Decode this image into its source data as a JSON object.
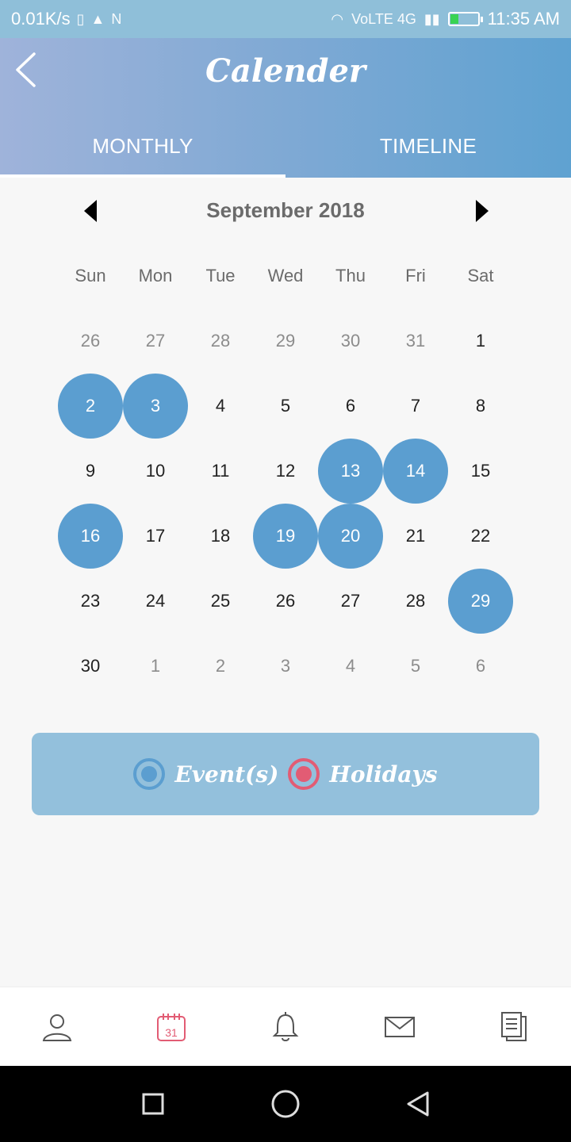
{
  "status_bar": {
    "speed": "0.01K/s",
    "carrier_text": "VoLTE 4G",
    "time": "11:35 AM",
    "battery_level": 0.3,
    "battery_color": "#39d353"
  },
  "header": {
    "title": "Calender",
    "tabs": [
      {
        "label": "MONTHLY",
        "active": true
      },
      {
        "label": "TIMELINE",
        "active": false
      }
    ]
  },
  "calendar": {
    "month_label": "September 2018",
    "weekdays": [
      "Sun",
      "Mon",
      "Tue",
      "Wed",
      "Thu",
      "Fri",
      "Sat"
    ],
    "days": [
      {
        "d": "26",
        "muted": true
      },
      {
        "d": "27",
        "muted": true
      },
      {
        "d": "28",
        "muted": true
      },
      {
        "d": "29",
        "muted": true
      },
      {
        "d": "30",
        "muted": true
      },
      {
        "d": "31",
        "muted": true
      },
      {
        "d": "1"
      },
      {
        "d": "2",
        "event": true
      },
      {
        "d": "3",
        "event": true
      },
      {
        "d": "4"
      },
      {
        "d": "5"
      },
      {
        "d": "6"
      },
      {
        "d": "7"
      },
      {
        "d": "8"
      },
      {
        "d": "9"
      },
      {
        "d": "10"
      },
      {
        "d": "11"
      },
      {
        "d": "12"
      },
      {
        "d": "13",
        "event": true
      },
      {
        "d": "14",
        "event": true
      },
      {
        "d": "15"
      },
      {
        "d": "16",
        "event": true
      },
      {
        "d": "17"
      },
      {
        "d": "18"
      },
      {
        "d": "19",
        "event": true
      },
      {
        "d": "20",
        "event": true
      },
      {
        "d": "21"
      },
      {
        "d": "22"
      },
      {
        "d": "23"
      },
      {
        "d": "24"
      },
      {
        "d": "25"
      },
      {
        "d": "26"
      },
      {
        "d": "27"
      },
      {
        "d": "28"
      },
      {
        "d": "29",
        "event": true
      },
      {
        "d": "30"
      },
      {
        "d": "1",
        "muted": true
      },
      {
        "d": "2",
        "muted": true
      },
      {
        "d": "3",
        "muted": true
      },
      {
        "d": "4",
        "muted": true
      },
      {
        "d": "5",
        "muted": true
      },
      {
        "d": "6",
        "muted": true
      }
    ],
    "event_color": "#5b9ed0"
  },
  "legend": {
    "events_label": "Event(s)",
    "holidays_label": "Holidays",
    "event_color": "#5b9ed0",
    "holiday_color": "#e25c74"
  },
  "bottom_nav": {
    "items": [
      {
        "icon": "profile-icon"
      },
      {
        "icon": "calendar-icon",
        "text": "31",
        "active": true
      },
      {
        "icon": "bell-icon"
      },
      {
        "icon": "mail-icon"
      },
      {
        "icon": "documents-icon"
      }
    ],
    "active_color": "#e25c74"
  }
}
